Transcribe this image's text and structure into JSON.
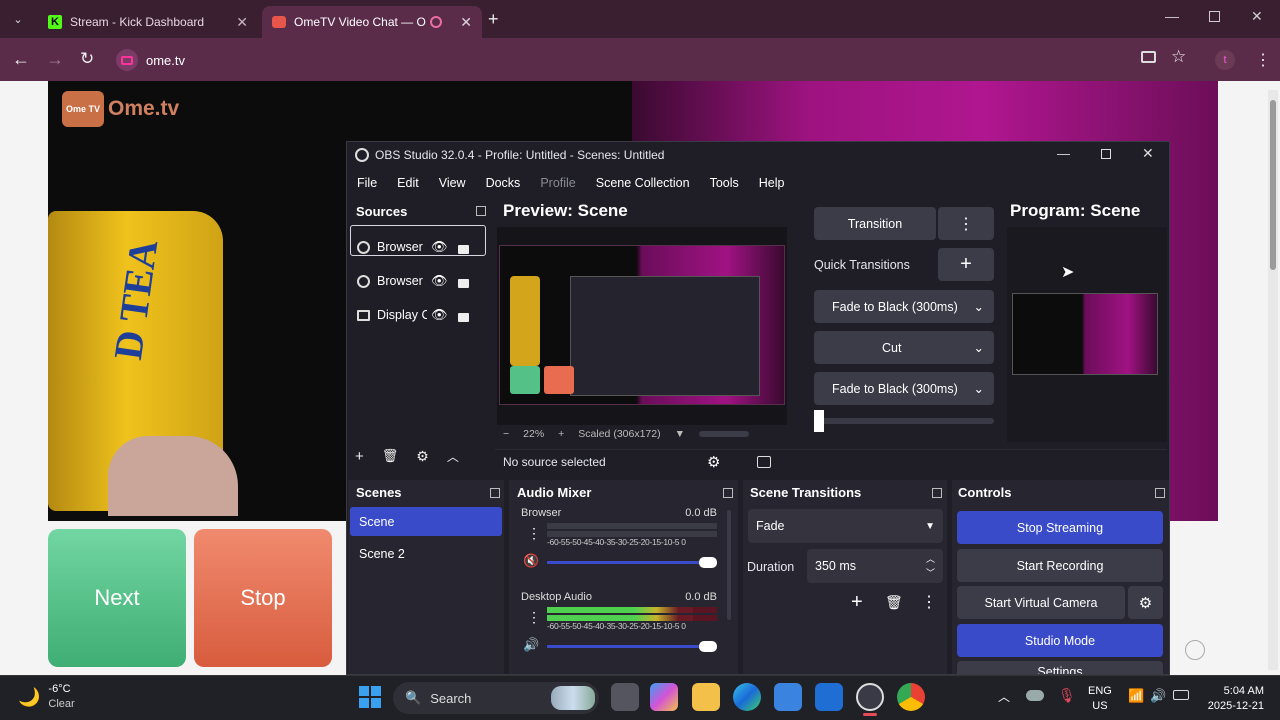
{
  "browser": {
    "tabs": [
      {
        "label": "Stream - Kick Dashboard"
      },
      {
        "label": "OmeTV Video Chat — Ome"
      }
    ],
    "url": "ome.tv",
    "profile_initial": "t"
  },
  "site": {
    "logo": "Ome.tv",
    "logo_badge": "Ome TV",
    "next_label": "Next",
    "stop_label": "Stop",
    "can_text": "D TEA"
  },
  "obs": {
    "title": "OBS Studio 32.0.4 - Profile: Untitled - Scenes: Untitled",
    "menu": [
      "File",
      "Edit",
      "View",
      "Docks",
      "Profile",
      "Scene Collection",
      "Tools",
      "Help"
    ],
    "sources_header": "Sources",
    "sources": [
      {
        "name": "Browser"
      },
      {
        "name": "Browser"
      },
      {
        "name": "Display C"
      }
    ],
    "preview_title": "Preview: Scene",
    "program_title": "Program: Scene",
    "transition_label": "Transition",
    "quick_transitions_label": "Quick Transitions",
    "quick_transitions": [
      "Fade to Black (300ms)",
      "Cut",
      "Fade to Black (300ms)"
    ],
    "zoom": "22%",
    "scaled": "Scaled (306x172)",
    "no_source": "No source selected",
    "scenes_header": "Scenes",
    "scenes": [
      "Scene",
      "Scene 2"
    ],
    "mixer_header": "Audio Mixer",
    "mixer": [
      {
        "name": "Browser",
        "db": "0.0 dB",
        "muted": true,
        "level": 0
      },
      {
        "name": "Desktop Audio",
        "db": "0.0 dB",
        "muted": false,
        "level": 0.86
      }
    ],
    "meter_scale": "-60-55-50-45-40-35-30-25-20-15-10-5 0",
    "st_header": "Scene Transitions",
    "st_value": "Fade",
    "duration_label": "Duration",
    "duration_value": "350 ms",
    "controls_header": "Controls",
    "controls": {
      "stop_streaming": "Stop Streaming",
      "start_recording": "Start Recording",
      "start_virtual_camera": "Start Virtual Camera",
      "studio_mode": "Studio Mode",
      "settings": "Settings"
    }
  },
  "taskbar": {
    "temp": "-6°C",
    "weather": "Clear",
    "search": "Search",
    "lang1": "ENG",
    "lang2": "US",
    "time": "5:04 AM",
    "date": "2025-12-21"
  },
  "colors": {
    "accent": "#3a4bc9",
    "next": "#54c187",
    "stop": "#e86c4f",
    "tab_bg": "#3a1f31",
    "toolbar": "#5a2c4a"
  }
}
